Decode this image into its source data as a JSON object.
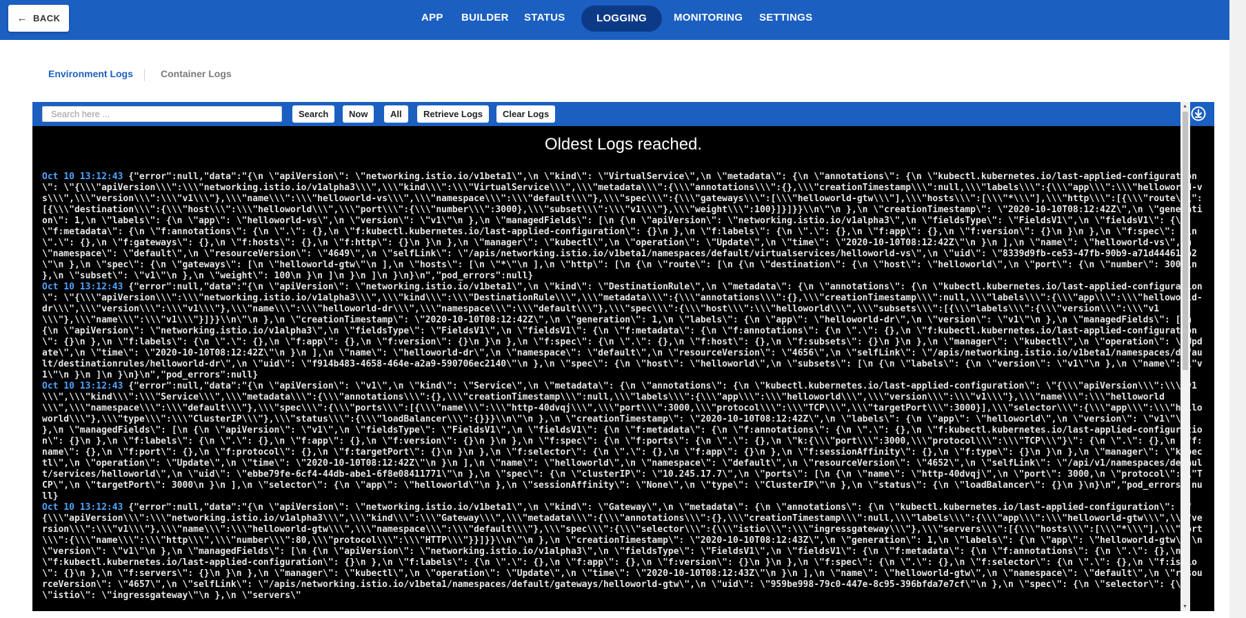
{
  "header": {
    "back_label": "BACK",
    "nav": [
      {
        "label": "APP"
      },
      {
        "label": "BUILDER"
      },
      {
        "label": "STATUS"
      },
      {
        "label": "LOGGING"
      },
      {
        "label": "MONITORING"
      },
      {
        "label": "SETTINGS"
      }
    ],
    "active_nav": "LOGGING"
  },
  "subtabs": {
    "environment": "Environment Logs",
    "container": "Container Logs"
  },
  "toolbar": {
    "search_placeholder": "Search here ...",
    "search_label": "Search",
    "now_label": "Now",
    "all_label": "All",
    "retrieve_label": "Retrieve Logs",
    "clear_label": "Clear Logs",
    "download_icon": "download-circle-icon"
  },
  "logs": {
    "status_message": "Oldest Logs reached.",
    "entries": [
      {
        "timestamp": "Oct 10 13:12:43",
        "text": "{\"error\":null,\"data\":\"{\\n \\\"apiVersion\\\": \\\"networking.istio.io/v1beta1\\\",\\n \\\"kind\\\": \\\"VirtualService\\\",\\n \\\"metadata\\\": {\\n \\\"annotations\\\": {\\n \\\"kubectl.kubernetes.io/last-applied-configuration\\\": \\\"{\\\\\\\"apiVersion\\\\\\\":\\\\\\\"networking.istio.io/v1alpha3\\\\\\\",\\\\\\\"kind\\\\\\\":\\\\\\\"VirtualService\\\\\\\",\\\\\\\"metadata\\\\\\\":{\\\\\\\"annotations\\\\\\\":{},\\\\\\\"creationTimestamp\\\\\\\":null,\\\\\\\"labels\\\\\\\":{\\\\\\\"app\\\\\\\":\\\\\\\"helloworld-vs\\\\\\\",\\\\\\\"version\\\\\\\":\\\\\\\"v1\\\\\\\"},\\\\\\\"name\\\\\\\":\\\\\\\"helloworld-vs\\\\\\\",\\\\\\\"namespace\\\\\\\":\\\\\\\"default\\\\\\\"},\\\\\\\"spec\\\\\\\":{\\\\\\\"gateways\\\\\\\":[\\\\\\\"helloworld-gtw\\\\\\\"],\\\\\\\"hosts\\\\\\\":[\\\\\\\"*\\\\\\\"],\\\\\\\"http\\\\\\\":[{\\\\\\\"route\\\\\\\":[{\\\\\\\"destination\\\\\\\":{\\\\\\\"host\\\\\\\":\\\\\\\"helloworld\\\\\\\",\\\\\\\"port\\\\\\\":{\\\\\\\"number\\\\\\\":3000},\\\\\\\"subset\\\\\\\":\\\\\\\"v1\\\\\\\"},\\\\\\\"weight\\\\\\\":100}]}]}}\\\\n\\\"\\n },\\n \\\"creationTimestamp\\\": \\\"2020-10-10T08:12:42Z\\\",\\n \\\"generation\\\": 1,\\n \\\"labels\\\": {\\n \\\"app\\\": \\\"helloworld-vs\\\",\\n \\\"version\\\": \\\"v1\\\"\\n },\\n \\\"managedFields\\\": [\\n {\\n \\\"apiVersion\\\": \\\"networking.istio.io/v1alpha3\\\",\\n \\\"fieldsType\\\": \\\"FieldsV1\\\",\\n \\\"fieldsV1\\\": {\\n \\\"f:metadata\\\": {\\n \\\"f:annotations\\\": {\\n \\\".\\\": {},\\n \\\"f:kubectl.kubernetes.io/last-applied-configuration\\\": {}\\n },\\n \\\"f:labels\\\": {\\n \\\".\\\": {},\\n \\\"f:app\\\": {},\\n \\\"f:version\\\": {}\\n }\\n },\\n \\\"f:spec\\\": {\\n \\\".\\\": {},\\n \\\"f:gateways\\\": {},\\n \\\"f:hosts\\\": {},\\n \\\"f:http\\\": {}\\n }\\n },\\n \\\"manager\\\": \\\"kubectl\\\",\\n \\\"operation\\\": \\\"Update\\\",\\n \\\"time\\\": \\\"2020-10-10T08:12:42Z\\\"\\n }\\n ],\\n \\\"name\\\": \\\"helloworld-vs\\\",\\n \\\"namespace\\\": \\\"default\\\",\\n \\\"resourceVersion\\\": \\\"4649\\\",\\n \\\"selfLink\\\": \\\"/apis/networking.istio.io/v1beta1/namespaces/default/virtualservices/helloworld-vs\\\",\\n \\\"uid\\\": \\\"8339d9fb-ce53-47fb-90b9-a71d444619b2\\\"\\n },\\n \\\"spec\\\": {\\n \\\"gateways\\\": [\\n \\\"helloworld-gtw\\\"\\n ],\\n \\\"hosts\\\": [\\n \\\"*\\\"\\n ],\\n \\\"http\\\": [\\n {\\n \\\"route\\\": [\\n {\\n \\\"destination\\\": {\\n \\\"host\\\": \\\"helloworld\\\",\\n \\\"port\\\": {\\n \\\"number\\\": 3000\\n },\\n \\\"subset\\\": \\\"v1\\\"\\n },\\n \\\"weight\\\": 100\\n }\\n ]\\n }\\n ]\\n }\\n}\\n\",\"pod_errors\":null}"
      },
      {
        "timestamp": "Oct 10 13:12:43",
        "text": "{\"error\":null,\"data\":\"{\\n \\\"apiVersion\\\": \\\"networking.istio.io/v1beta1\\\",\\n \\\"kind\\\": \\\"DestinationRule\\\",\\n \\\"metadata\\\": {\\n \\\"annotations\\\": {\\n \\\"kubectl.kubernetes.io/last-applied-configuration\\\": \\\"{\\\\\\\"apiVersion\\\\\\\":\\\\\\\"networking.istio.io/v1alpha3\\\\\\\",\\\\\\\"kind\\\\\\\":\\\\\\\"DestinationRule\\\\\\\",\\\\\\\"metadata\\\\\\\":{\\\\\\\"annotations\\\\\\\":{},\\\\\\\"creationTimestamp\\\\\\\":null,\\\\\\\"labels\\\\\\\":{\\\\\\\"app\\\\\\\":\\\\\\\"helloworld-dr\\\\\\\",\\\\\\\"version\\\\\\\":\\\\\\\"v1\\\\\\\"},\\\\\\\"name\\\\\\\":\\\\\\\"helloworld-dr\\\\\\\",\\\\\\\"namespace\\\\\\\":\\\\\\\"default\\\\\\\"},\\\\\\\"spec\\\\\\\":{\\\\\\\"host\\\\\\\":\\\\\\\"helloworld\\\\\\\",\\\\\\\"subsets\\\\\\\":[{\\\\\\\"labels\\\\\\\":{\\\\\\\"version\\\\\\\":\\\\\\\"v1\\\\\\\"},\\\\\\\"name\\\\\\\":\\\\\\\"v1\\\\\\\"}]}}\\\\n\\\"\\n },\\n \\\"creationTimestamp\\\": \\\"2020-10-10T08:12:42Z\\\",\\n \\\"generation\\\": 1,\\n \\\"labels\\\": {\\n \\\"app\\\": \\\"helloworld-dr\\\",\\n \\\"version\\\": \\\"v1\\\"\\n },\\n \\\"managedFields\\\": [\\n {\\n \\\"apiVersion\\\": \\\"networking.istio.io/v1alpha3\\\",\\n \\\"fieldsType\\\": \\\"FieldsV1\\\",\\n \\\"fieldsV1\\\": {\\n \\\"f:metadata\\\": {\\n \\\"f:annotations\\\": {\\n \\\".\\\": {},\\n \\\"f:kubectl.kubernetes.io/last-applied-configuration\\\": {}\\n },\\n \\\"f:labels\\\": {\\n \\\".\\\": {},\\n \\\"f:app\\\": {},\\n \\\"f:version\\\": {}\\n }\\n },\\n \\\"f:spec\\\": {\\n \\\".\\\": {},\\n \\\"f:host\\\": {},\\n \\\"f:subsets\\\": {}\\n }\\n },\\n \\\"manager\\\": \\\"kubectl\\\",\\n \\\"operation\\\": \\\"Update\\\",\\n \\\"time\\\": \\\"2020-10-10T08:12:42Z\\\"\\n }\\n ],\\n \\\"name\\\": \\\"helloworld-dr\\\",\\n \\\"namespace\\\": \\\"default\\\",\\n \\\"resourceVersion\\\": \\\"4656\\\",\\n \\\"selfLink\\\": \\\"/apis/networking.istio.io/v1beta1/namespaces/default/destinationrules/helloworld-dr\\\",\\n \\\"uid\\\": \\\"f914b483-4658-464e-a2a9-590706ec2140\\\"\\n },\\n \\\"spec\\\": {\\n \\\"host\\\": \\\"helloworld\\\",\\n \\\"subsets\\\": [\\n {\\n \\\"labels\\\": {\\n \\\"version\\\": \\\"v1\\\"\\n },\\n \\\"name\\\": \\\"v1\\\"\\n }\\n ]\\n }\\n}\\n\",\"pod_errors\":null}"
      },
      {
        "timestamp": "Oct 10 13:12:43",
        "text": "{\"error\":null,\"data\":\"{\\n \\\"apiVersion\\\": \\\"v1\\\",\\n \\\"kind\\\": \\\"Service\\\",\\n \\\"metadata\\\": {\\n \\\"annotations\\\": {\\n \\\"kubectl.kubernetes.io/last-applied-configuration\\\": \\\"{\\\\\\\"apiVersion\\\\\\\":\\\\\\\"v1\\\\\\\",\\\\\\\"kind\\\\\\\":\\\\\\\"Service\\\\\\\",\\\\\\\"metadata\\\\\\\":{\\\\\\\"annotations\\\\\\\":{},\\\\\\\"creationTimestamp\\\\\\\":null,\\\\\\\"labels\\\\\\\":{\\\\\\\"app\\\\\\\":\\\\\\\"helloworld\\\\\\\",\\\\\\\"version\\\\\\\":\\\\\\\"v1\\\\\\\"},\\\\\\\"name\\\\\\\":\\\\\\\"helloworld\\\\\\\",\\\\\\\"namespace\\\\\\\":\\\\\\\"default\\\\\\\"},\\\\\\\"spec\\\\\\\":{\\\\\\\"ports\\\\\\\":[{\\\\\\\"name\\\\\\\":\\\\\\\"http-40dvqj\\\\\\\",\\\\\\\"port\\\\\\\":3000,\\\\\\\"protocol\\\\\\\":\\\\\\\"TCP\\\\\\\",\\\\\\\"targetPort\\\\\\\":3000}],\\\\\\\"selector\\\\\\\":{\\\\\\\"app\\\\\\\":\\\\\\\"helloworld\\\\\\\"},\\\\\\\"type\\\\\\\":\\\\\\\"ClusterIP\\\\\\\"},\\\\\\\"status\\\\\\\":{\\\\\\\"loadBalancer\\\\\\\":{}}}\\\\n\\\"\\n },\\n \\\"creationTimestamp\\\": \\\"2020-10-10T08:12:42Z\\\",\\n \\\"labels\\\": {\\n \\\"app\\\": \\\"helloworld\\\",\\n \\\"version\\\": \\\"v1\\\"\\n },\\n \\\"managedFields\\\": [\\n {\\n \\\"apiVersion\\\": \\\"v1\\\",\\n \\\"fieldsType\\\": \\\"FieldsV1\\\",\\n \\\"fieldsV1\\\": {\\n \\\"f:metadata\\\": {\\n \\\"f:annotations\\\": {\\n \\\".\\\": {},\\n \\\"f:kubectl.kubernetes.io/last-applied-configuration\\\": {}\\n },\\n \\\"f:labels\\\": {\\n \\\".\\\": {},\\n \\\"f:app\\\": {},\\n \\\"f:version\\\": {}\\n }\\n },\\n \\\"f:spec\\\": {\\n \\\"f:ports\\\": {\\n \\\".\\\": {},\\n \\\"k:{\\\\\\\"port\\\\\\\":3000,\\\\\\\"protocol\\\\\\\":\\\\\\\"TCP\\\\\\\"}\\\": {\\n \\\".\\\": {},\\n \\\"f:name\\\": {},\\n \\\"f:port\\\": {},\\n \\\"f:protocol\\\": {},\\n \\\"f:targetPort\\\": {}\\n }\\n },\\n \\\"f:selector\\\": {\\n \\\".\\\": {},\\n \\\"f:app\\\": {}\\n },\\n \\\"f:sessionAffinity\\\": {},\\n \\\"f:type\\\": {}\\n }\\n },\\n \\\"manager\\\": \\\"kubectl\\\",\\n \\\"operation\\\": \\\"Update\\\",\\n \\\"time\\\": \\\"2020-10-10T08:12:42Z\\\"\\n }\\n ],\\n \\\"name\\\": \\\"helloworld\\\",\\n \\\"namespace\\\": \\\"default\\\",\\n \\\"resourceVersion\\\": \\\"4652\\\",\\n \\\"selfLink\\\": \\\"/api/v1/namespaces/default/services/helloworld\\\",\\n \\\"uid\\\": \\\"ebbe79fe-6cf4-44db-abe1-6f8e08411771\\\"\\n },\\n \\\"spec\\\": {\\n \\\"clusterIP\\\": \\\"10.245.17.7\\\",\\n \\\"ports\\\": [\\n {\\n \\\"name\\\": \\\"http-40dvqj\\\",\\n \\\"port\\\": 3000,\\n \\\"protocol\\\": \\\"TCP\\\",\\n \\\"targetPort\\\": 3000\\n }\\n ],\\n \\\"selector\\\": {\\n \\\"app\\\": \\\"helloworld\\\"\\n },\\n \\\"sessionAffinity\\\": \\\"None\\\",\\n \\\"type\\\": \\\"ClusterIP\\\"\\n },\\n \\\"status\\\": {\\n \\\"loadBalancer\\\": {}\\n }\\n}\\n\",\"pod_errors\":null}"
      },
      {
        "timestamp": "Oct 10 13:12:43",
        "text": "{\"error\":null,\"data\":\"{\\n \\\"apiVersion\\\": \\\"networking.istio.io/v1beta1\\\",\\n \\\"kind\\\": \\\"Gateway\\\",\\n \\\"metadata\\\": {\\n \\\"annotations\\\": {\\n \\\"kubectl.kubernetes.io/last-applied-configuration\\\": \\\"{\\\\\\\"apiVersion\\\\\\\":\\\\\\\"networking.istio.io/v1alpha3\\\\\\\",\\\\\\\"kind\\\\\\\":\\\\\\\"Gateway\\\\\\\",\\\\\\\"metadata\\\\\\\":{\\\\\\\"annotations\\\\\\\":{},\\\\\\\"creationTimestamp\\\\\\\":null,\\\\\\\"labels\\\\\\\":{\\\\\\\"app\\\\\\\":\\\\\\\"helloworld-gtw\\\\\\\",\\\\\\\"version\\\\\\\":\\\\\\\"v1\\\\\\\"},\\\\\\\"name\\\\\\\":\\\\\\\"helloworld-gtw\\\\\\\",\\\\\\\"namespace\\\\\\\":\\\\\\\"default\\\\\\\"},\\\\\\\"spec\\\\\\\":{\\\\\\\"selector\\\\\\\":{\\\\\\\"istio\\\\\\\":\\\\\\\"ingressgateway\\\\\\\"},\\\\\\\"servers\\\\\\\":[{\\\\\\\"hosts\\\\\\\":[\\\\\\\"*\\\\\\\"],\\\\\\\"port\\\\\\\":{\\\\\\\"name\\\\\\\":\\\\\\\"http\\\\\\\",\\\\\\\"number\\\\\\\":80,\\\\\\\"protocol\\\\\\\":\\\\\\\"HTTP\\\\\\\"}}]}}\\\\n\\\"\\n },\\n \\\"creationTimestamp\\\": \\\"2020-10-10T08:12:43Z\\\",\\n \\\"generation\\\": 1,\\n \\\"labels\\\": {\\n \\\"app\\\": \\\"helloworld-gtw\\\",\\n \\\"version\\\": \\\"v1\\\"\\n },\\n \\\"managedFields\\\": [\\n {\\n \\\"apiVersion\\\": \\\"networking.istio.io/v1alpha3\\\",\\n \\\"fieldsType\\\": \\\"FieldsV1\\\",\\n \\\"fieldsV1\\\": {\\n \\\"f:metadata\\\": {\\n \\\"f:annotations\\\": {\\n \\\".\\\": {},\\n \\\"f:kubectl.kubernetes.io/last-applied-configuration\\\": {}\\n },\\n \\\"f:labels\\\": {\\n \\\".\\\": {},\\n \\\"f:app\\\": {},\\n \\\"f:version\\\": {}\\n }\\n },\\n \\\"f:spec\\\": {\\n \\\".\\\": {},\\n \\\"f:selector\\\": {\\n \\\".\\\": {},\\n \\\"f:istio\\\": {}\\n },\\n \\\"f:servers\\\": {}\\n }\\n },\\n \\\"manager\\\": \\\"kubectl\\\",\\n \\\"operation\\\": \\\"Update\\\",\\n \\\"time\\\": \\\"2020-10-10T08:12:43Z\\\"\\n }\\n ],\\n \\\"name\\\": \\\"helloworld-gtw\\\",\\n \\\"namespace\\\": \\\"default\\\",\\n \\\"resourceVersion\\\": \\\"4657\\\",\\n \\\"selfLink\\\": \\\"/apis/networking.istio.io/v1beta1/namespaces/default/gateways/helloworld-gtw\\\",\\n \\\"uid\\\": \\\"959be998-79c0-447e-8c95-396bfda7e7cf\\\"\\n },\\n \\\"spec\\\": {\\n \\\"selector\\\": {\\n \\\"istio\\\": \\\"ingressgateway\\\"\\n },\\n \\\"servers\\\""
      }
    ]
  },
  "colors": {
    "brand_blue": "#1b5fc1",
    "active_nav": "#0d3a87",
    "log_background": "#000000",
    "timestamp": "#4ea4ff"
  }
}
